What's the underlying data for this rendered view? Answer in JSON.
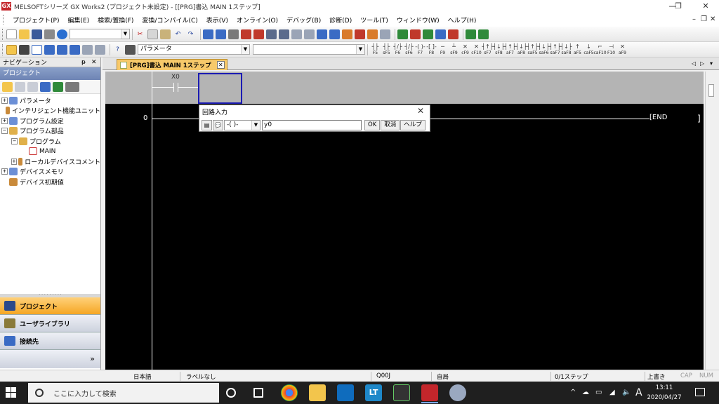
{
  "titlebar": {
    "title": "MELSOFTシリーズ GX Works2 (プロジェクト未設定) - [[PRG]書込 MAIN 1ステップ]",
    "logo": "GX",
    "controls": [
      "—",
      "❐",
      "✕"
    ]
  },
  "menubar": {
    "items": [
      "プロジェクト(P)",
      "編集(E)",
      "検索/置換(F)",
      "変換/コンパイル(C)",
      "表示(V)",
      "オンライン(O)",
      "デバッグ(B)",
      "診断(D)",
      "ツール(T)",
      "ウィンドウ(W)",
      "ヘルプ(H)"
    ],
    "mdi_controls": [
      "–",
      "❐",
      "✕"
    ]
  },
  "toolbar2": {
    "parameter_combo": "パラメータ",
    "fkeys": [
      {
        "sym": "┤├",
        "label": "F5"
      },
      {
        "sym": "┤├",
        "label": "sF5"
      },
      {
        "sym": "┤/├",
        "label": "F6"
      },
      {
        "sym": "┤/├",
        "label": "sF6"
      },
      {
        "sym": "-( )-",
        "label": "F7"
      },
      {
        "sym": "-[ ]-",
        "label": "F8"
      },
      {
        "sym": "─",
        "label": "F9"
      },
      {
        "sym": "┴",
        "label": "sF9"
      },
      {
        "sym": "✕",
        "label": "cF9"
      },
      {
        "sym": "✕",
        "label": "cF10"
      },
      {
        "sym": "┤↑├",
        "label": "sF7"
      },
      {
        "sym": "┤↓├",
        "label": "sF8"
      },
      {
        "sym": "┤↑├",
        "label": "aF7"
      },
      {
        "sym": "┤↓├",
        "label": "aF8"
      },
      {
        "sym": "┤↑├",
        "label": "saF5"
      },
      {
        "sym": "┤↓├",
        "label": "saF6"
      },
      {
        "sym": "┤↑├",
        "label": "saF7"
      },
      {
        "sym": "┤↓├",
        "label": "saF8"
      },
      {
        "sym": "↑",
        "label": "aF5"
      },
      {
        "sym": "↓",
        "label": "caF5"
      },
      {
        "sym": "⌐",
        "label": "caF10"
      },
      {
        "sym": "⊣",
        "label": "F10"
      },
      {
        "sym": "✕",
        "label": "aF9"
      }
    ]
  },
  "navigation": {
    "header": "ナビゲーション",
    "pin": "ᵽ",
    "close": "✕",
    "project_header": "プロジェクト",
    "tree": [
      {
        "label": "パラメータ",
        "indent": 0,
        "exp": "+"
      },
      {
        "label": "インテリジェント機能ユニット",
        "indent": 0,
        "exp": ""
      },
      {
        "label": "プログラム設定",
        "indent": 0,
        "exp": "+"
      },
      {
        "label": "プログラム部品",
        "indent": 0,
        "exp": "−"
      },
      {
        "label": "プログラム",
        "indent": 1,
        "exp": "−"
      },
      {
        "label": "MAIN",
        "indent": 2,
        "exp": ""
      },
      {
        "label": "ローカルデバイスコメント",
        "indent": 1,
        "exp": "+"
      },
      {
        "label": "デバイスメモリ",
        "indent": 0,
        "exp": "+"
      },
      {
        "label": "デバイス初期値",
        "indent": 0,
        "exp": ""
      }
    ],
    "bottom_buttons": [
      "プロジェクト",
      "ユーザライブラリ",
      "接続先"
    ],
    "chevron": "»"
  },
  "editor": {
    "tab_label": "[PRG]書込 MAIN 1ステップ",
    "tab_close": "✕",
    "tab_nav": [
      "◁",
      "▷",
      "▾"
    ],
    "contact_label": "X0",
    "step_number": "0",
    "end_label": "END"
  },
  "dialog": {
    "title": "回路入力",
    "close": "✕",
    "instruction_select": "-( )-",
    "input_value": "y0",
    "ok": "OK",
    "cancel": "取消",
    "help": "ヘルプ"
  },
  "statusbar": {
    "language": "日本語",
    "label": "ラベルなし",
    "cpu": "Q00J",
    "station": "自局",
    "steps": "0/1ステップ",
    "mode": "上書き",
    "caps": "CAP",
    "num": "NUM"
  },
  "taskbar": {
    "search_placeholder": "ここに入力して検索",
    "tray_icons": [
      "^",
      "☁",
      "▭",
      "◢",
      "🔈",
      "A"
    ],
    "time": "13:11",
    "date": "2020/04/27"
  }
}
